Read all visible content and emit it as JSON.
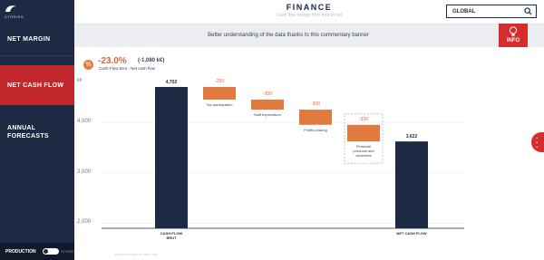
{
  "app": {
    "brand_name": "STORIES",
    "title": "FINANCE",
    "subtitle": "Cash flow bridge from brut to net",
    "search_value": "GLOBAL"
  },
  "sidebar": {
    "items": [
      {
        "label": "NET MARGIN"
      },
      {
        "label": "NET CASH FLOW",
        "active": true
      },
      {
        "label": "ANNUAL\nFORECASTS"
      }
    ],
    "footer": {
      "mode_label": "PRODUCTION",
      "story_label": "STORIES"
    }
  },
  "banner": {
    "text": "Better understanding of the data thanks to this commentary banner",
    "info_label": "INFO"
  },
  "kpi": {
    "percent": "-23.0%",
    "absolute": "(-1,080 k€)",
    "subtitle": "Cash-Flow Brut - Net cash flow"
  },
  "bottom_note": "Waterfall chart of cash flow",
  "colors": {
    "navy": "#1c2a44",
    "accent_red": "#c0262c",
    "step_orange": "#e07a3f"
  },
  "icons": {
    "logo": "bird-logo-icon",
    "search": "search-icon",
    "info": "lightbulb-icon",
    "kpi": "percent-icon",
    "side": "more-options-icon"
  },
  "chart_data": {
    "type": "bar",
    "unit_label": "k€",
    "categories": [
      "CASH-FLOW BRUT",
      "Tax participation",
      "Staff expenditure",
      "Profits sharing",
      "Financial products and expenses",
      "NET CASH FLOW"
    ],
    "values": [
      4702,
      -250,
      -200,
      -300,
      -330,
      3622
    ],
    "value_labels": [
      "4,702",
      "-250",
      "-200",
      "-300",
      "-330",
      "3,622"
    ],
    "kinds": [
      "total",
      "step",
      "step",
      "step",
      "step-dashed",
      "total"
    ],
    "x_labels": [
      "CASH-FLOW\nBRUT",
      "Tax participation",
      "Staff expenditure",
      "Profits sharing",
      "Financial\nproducts and\nexpenses",
      "NET CASH FLOW"
    ],
    "yticks": [
      "4,000",
      "3,000",
      "2,000"
    ],
    "ytick_values": [
      4000,
      3000,
      2000
    ],
    "ylim": [
      1900,
      4900
    ],
    "grid": true
  }
}
